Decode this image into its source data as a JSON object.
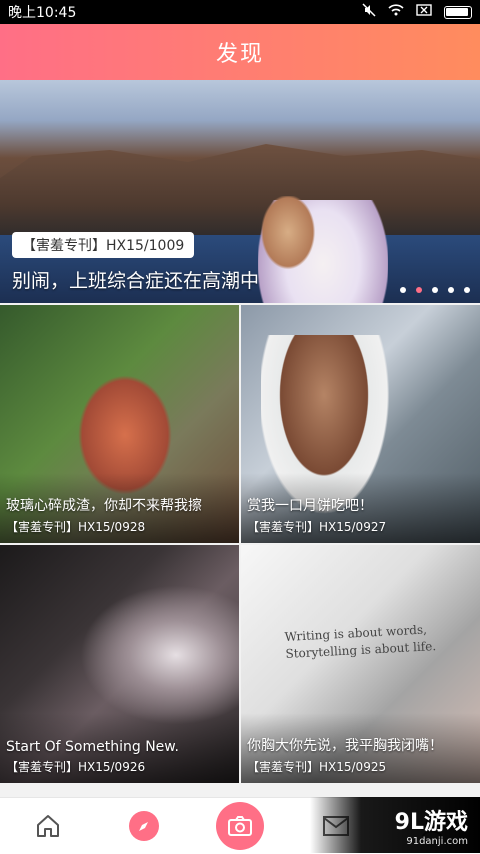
{
  "statusbar": {
    "time": "晚上10:45"
  },
  "header": {
    "title": "发现"
  },
  "hero": {
    "tag": "【害羞专刊】HX15/1009",
    "title": "别闹，上班综合症还在高潮中",
    "dots_total": 5,
    "active_dot": 2
  },
  "cards": [
    {
      "title": "玻璃心碎成渣，你却不来帮我擦",
      "sub": "【害羞专刊】HX15/0928"
    },
    {
      "title": "赏我一口月饼吃吧！",
      "sub": "【害羞专刊】HX15/0927"
    },
    {
      "title": "Start Of Something New.",
      "sub": "【害羞专刊】HX15/0926"
    },
    {
      "title": "你胸大你先说，我平胸我闭嘴！",
      "sub": "【害羞专刊】HX15/0925"
    }
  ],
  "card4_writing": {
    "line1": "Writing is about words,",
    "line2": "Storytelling is about life."
  },
  "watermark": {
    "logo": "9L游戏",
    "url": "91danji.com"
  },
  "colors": {
    "accent": "#ff6f86",
    "accent2": "#ff8c5e"
  }
}
